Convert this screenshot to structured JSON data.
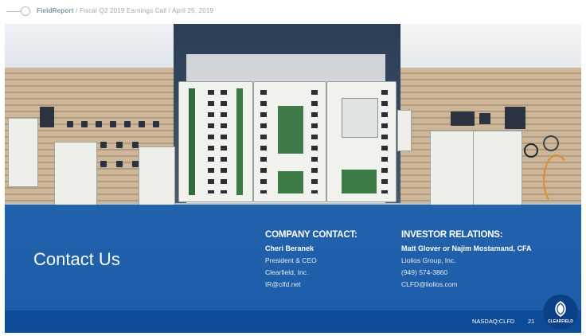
{
  "header": {
    "brand": "FieldReport",
    "breadcrumb": "/ Fiscal Q2 2019 Earnings Call / April 25, 2019"
  },
  "slide": {
    "title": "Contact Us",
    "company_contact": {
      "heading": "COMPANY CONTACT:",
      "name": "Cheri Beranek",
      "lines": [
        "President & CEO",
        "Clearfield, Inc.",
        "IR@clfd.net"
      ]
    },
    "investor_relations": {
      "heading": "INVESTOR RELATIONS:",
      "name": "Matt Glover or Najim Mostamand, CFA",
      "lines": [
        "Liolios Group, Inc.",
        "(949) 574-3860",
        "CLFD@liolios.com"
      ]
    },
    "footer": {
      "ticker": "NASDAQ:CLFD",
      "page_number": "21",
      "logo_text": "CLEARFIELD"
    }
  },
  "colors": {
    "band": "#1256a8",
    "footer": "#0e4c99",
    "text": "#ffffff"
  }
}
